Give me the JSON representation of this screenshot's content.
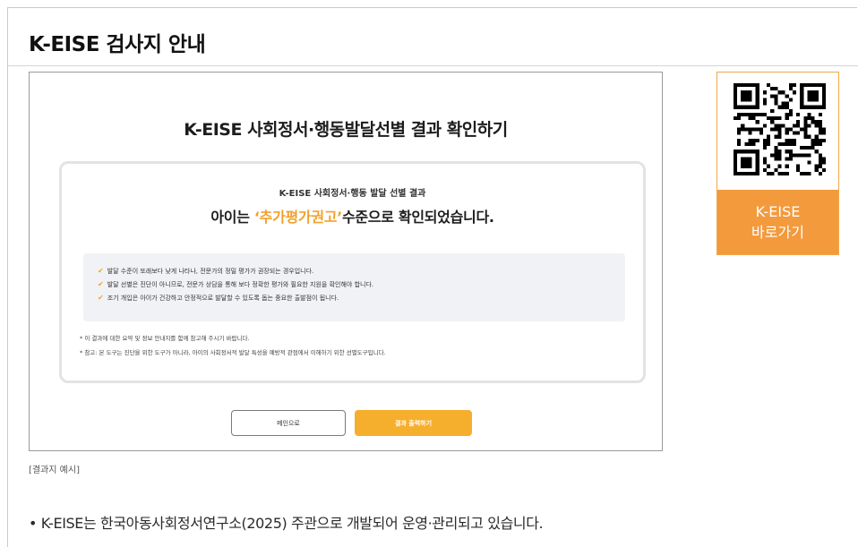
{
  "guide": {
    "title": "K-EISE 검사지 안내"
  },
  "result": {
    "heading": "K-EISE 사회정서·행동발달선별 결과 확인하기",
    "card": {
      "subtitle": "K-EISE 사회정서·행동 발달 선별 결과",
      "main_prefix": "아이는 ",
      "main_highlight": "‘추가평가권고’",
      "main_suffix": "수준으로 확인되었습니다.",
      "checklist": [
        "발달 수준이 또래보다 낮게 나타나, 전문가의 정밀 평가가 권장되는 경우입니다.",
        "발달 선별은 진단이 아니므로, 전문가 상담을 통해 보다 정확한 평가와 필요한 지원을 확인해야 합니다.",
        "조기 개입은 아이가 건강하고 안정적으로 발달할 수 있도록 돕는 중요한 출발점이 됩니다."
      ],
      "notes": [
        "* 이 결과에 대한 요약 및 정보 안내지를 함께 참고해 주시기 바랍니다.",
        "* 참고: 본 도구는 진단을 위한 도구가 아니라, 아이의 사회정서적 발달 특성을 예방적 관점에서 이해하기 위한 선별도구입니다."
      ]
    },
    "buttons": {
      "main": "메인으로",
      "print": "결과 출력하기"
    }
  },
  "caption": "[결과지 예시]",
  "qr": {
    "label_line1": "K-EISE",
    "label_line2": "바로가기"
  },
  "footer": {
    "note": "• K-EISE는 한국아동사회정서연구소(2025) 주관으로 개발되어 운영·관리되고 있습니다."
  },
  "colors": {
    "accent": "#f39a3d",
    "highlight": "#f2a12c",
    "button": "#f6ae2d"
  },
  "icons": {
    "check": "check-icon",
    "qr": "qr-code-icon"
  }
}
